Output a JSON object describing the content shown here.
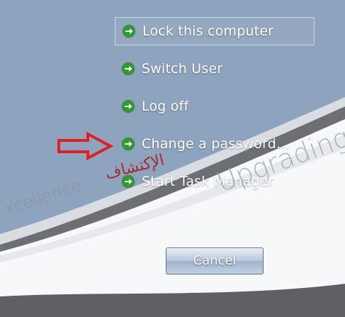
{
  "menu": {
    "items": [
      {
        "label": "Lock this computer"
      },
      {
        "label": "Switch User"
      },
      {
        "label": "Log off"
      },
      {
        "label": "Change a password..."
      },
      {
        "label": "Start Task Manager"
      }
    ]
  },
  "cancel_label": "Cancel",
  "watermark": {
    "left_text": "xcellence",
    "arabic_text": "الإكتشاف",
    "right_text": "Upgrading"
  },
  "colors": {
    "background": "#8fa4bf",
    "annotation_arrow": "#e02020",
    "menu_arrow": "#2f9a2f"
  }
}
